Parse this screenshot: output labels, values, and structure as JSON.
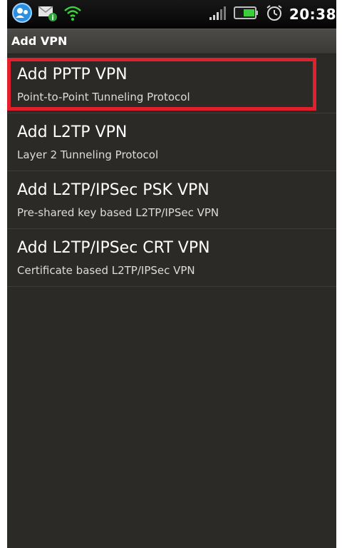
{
  "status_bar": {
    "time": "20:38",
    "icons": [
      "chat-bubble-icon",
      "email-notification-icon",
      "wifi-icon",
      "signal-icon",
      "battery-icon",
      "alarm-icon"
    ]
  },
  "title_bar": {
    "title": "Add VPN"
  },
  "list": {
    "items": [
      {
        "title": "Add PPTP VPN",
        "subtitle": "Point-to-Point Tunneling Protocol",
        "highlighted": true
      },
      {
        "title": "Add L2TP VPN",
        "subtitle": "Layer 2 Tunneling Protocol"
      },
      {
        "title": "Add L2TP/IPSec PSK VPN",
        "subtitle": "Pre-shared key based L2TP/IPSec VPN"
      },
      {
        "title": "Add L2TP/IPSec CRT VPN",
        "subtitle": "Certificate based L2TP/IPSec VPN"
      }
    ]
  },
  "colors": {
    "background": "#2b2a26",
    "highlight_border": "#e0202c",
    "wifi": "#3ccf3c"
  }
}
